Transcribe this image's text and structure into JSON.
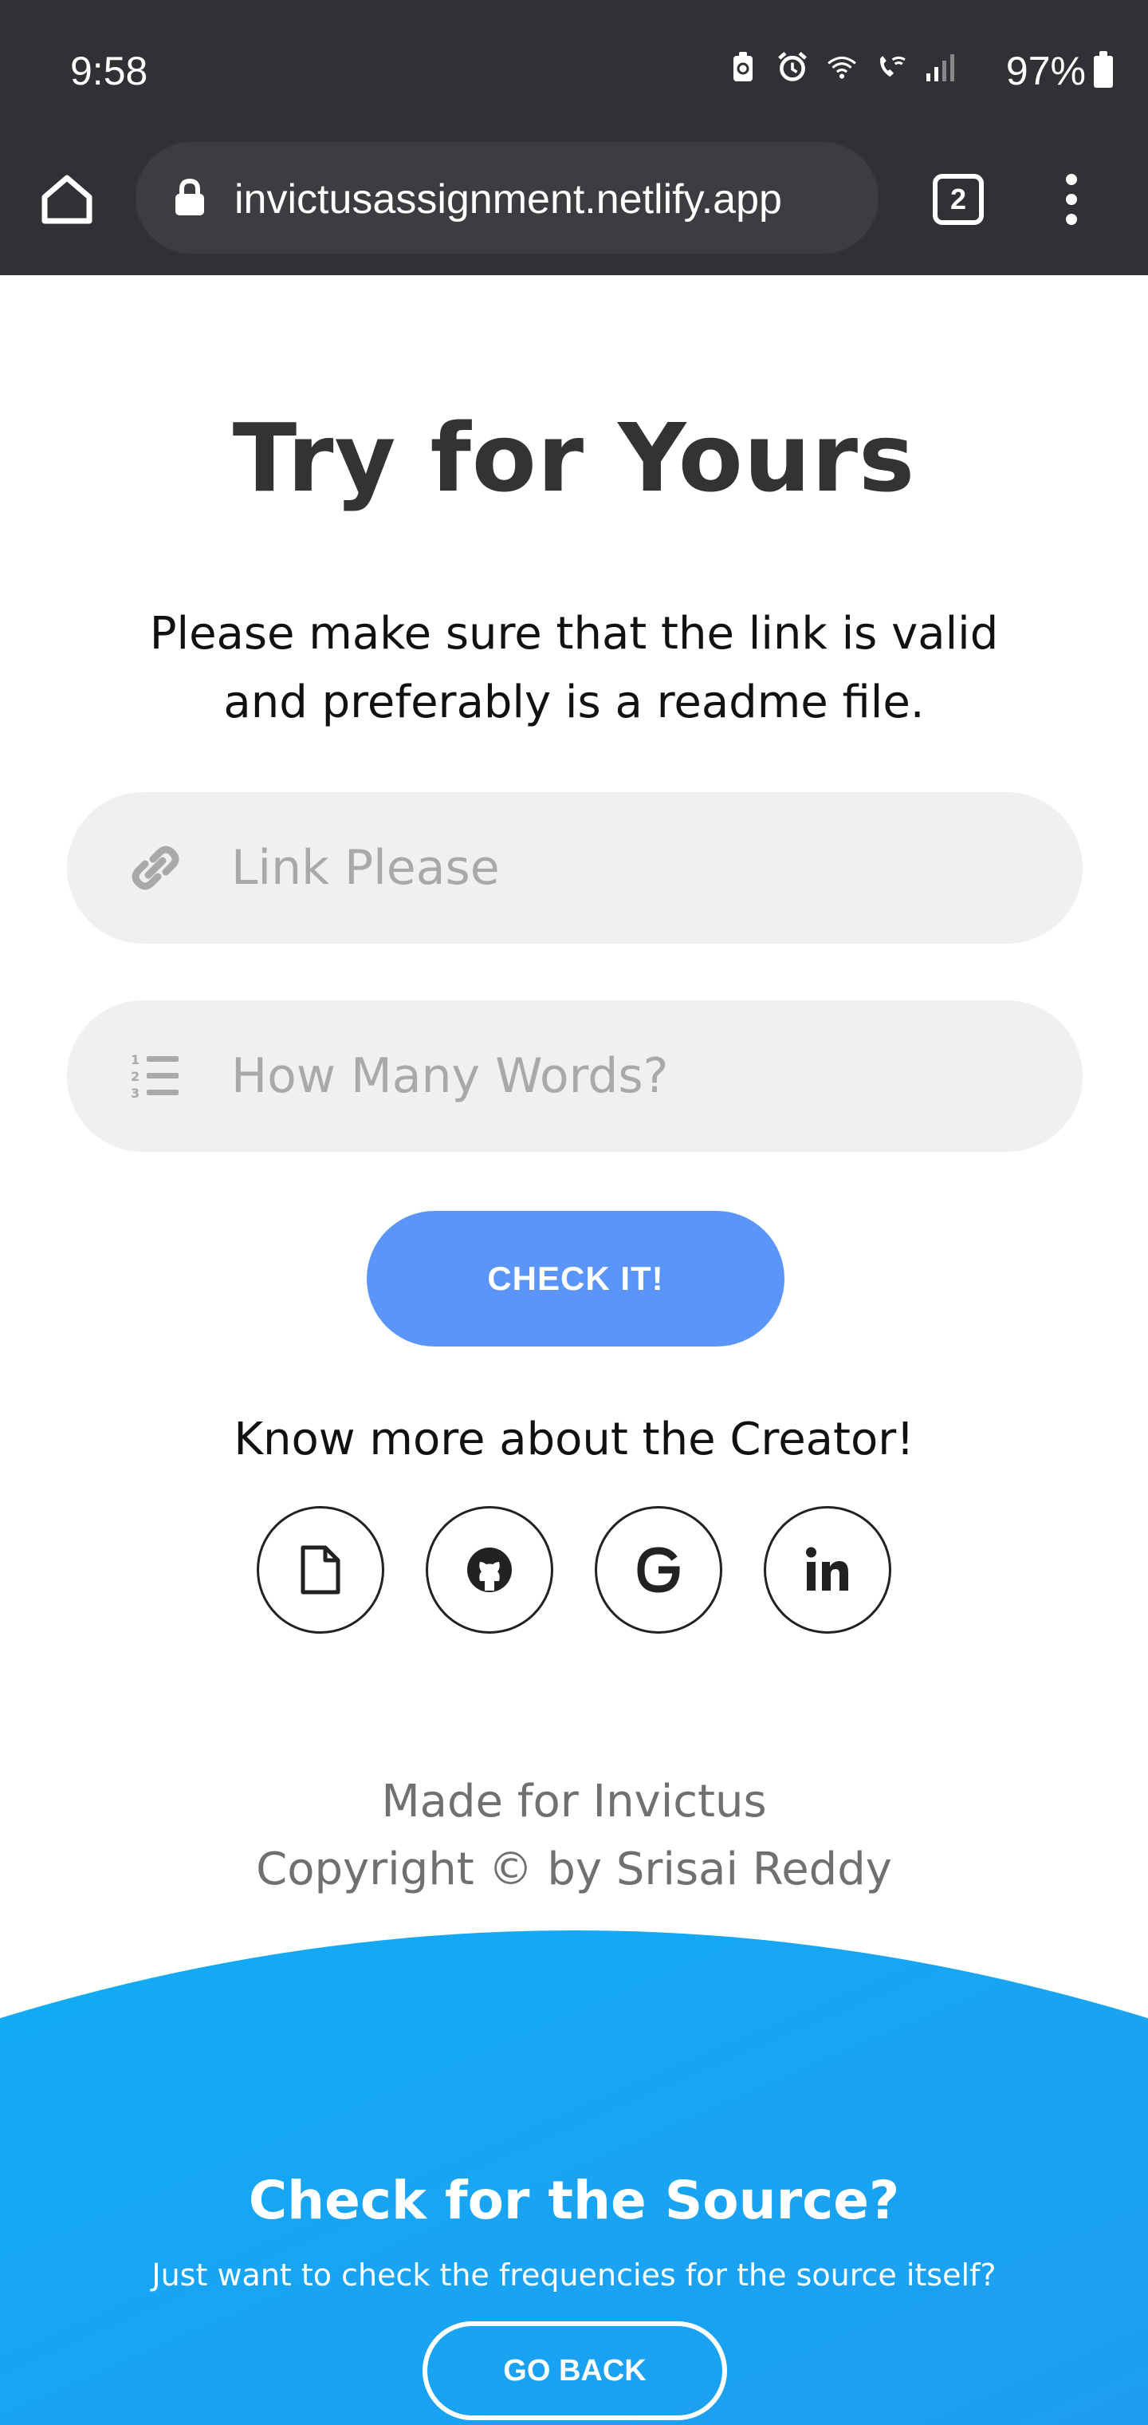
{
  "status_bar": {
    "time": "9:58",
    "battery": "97%",
    "icons": [
      "battery-saver-icon",
      "alarm-icon",
      "wifi-icon",
      "wifi-calling-icon",
      "signal-icon"
    ]
  },
  "browser": {
    "url": "invictusassignment.netlify.app",
    "tab_count": "2",
    "icons": [
      "home-icon",
      "lock-icon",
      "tabs-icon",
      "more-vert-icon"
    ]
  },
  "main": {
    "title": "Try for Yours",
    "subtitle_line1": "Please make sure that the link is valid",
    "subtitle_line2": "and preferably is a readme file.",
    "link_field": {
      "placeholder": "Link Please",
      "value": "",
      "icon": "link-icon"
    },
    "words_field": {
      "placeholder": "How Many Words?",
      "value": "",
      "icon": "numbered-list-icon"
    },
    "check_button": "CHECK IT!",
    "creator_text": "Know more about the Creator!",
    "socials": [
      "document-icon",
      "github-icon",
      "google-icon",
      "linkedin-icon"
    ]
  },
  "footer": {
    "made_for": "Made for Invictus",
    "copyright": "Copyright © by Srisai Reddy"
  },
  "source_section": {
    "title": "Check for the Source?",
    "subtitle": "Just want to check the frequencies for the source itself?",
    "button": "GO BACK"
  },
  "colors": {
    "chrome": "#303134",
    "accent_button": "#5b95f9",
    "wave": "#1aa7f2",
    "title": "#333333"
  }
}
